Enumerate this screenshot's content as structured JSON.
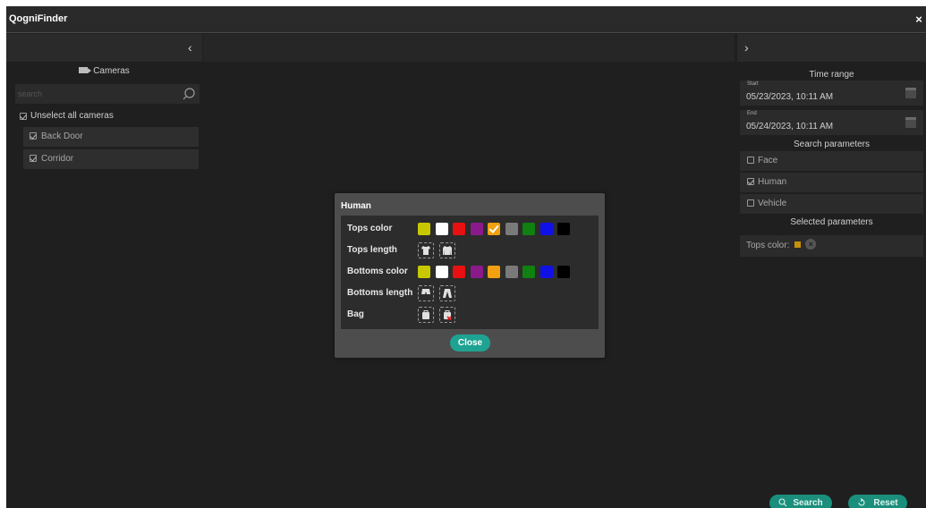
{
  "app": {
    "title": "QogniFinder",
    "close_glyph": "×"
  },
  "nav": {
    "left_chevron": "‹",
    "right_chevron": "›"
  },
  "cameras": {
    "header": "Cameras",
    "search_placeholder": "search",
    "unselect_all_label": "Unselect all cameras",
    "items": [
      {
        "label": "Back Door",
        "checked": true
      },
      {
        "label": "Corridor",
        "checked": true
      }
    ]
  },
  "time_range": {
    "title": "Time range",
    "start_label": "Start",
    "start_value": "05/23/2023, 10:11 AM",
    "end_label": "End",
    "end_value": "05/24/2023, 10:11 AM"
  },
  "search_parameters": {
    "title": "Search parameters",
    "items": [
      {
        "label": "Face",
        "checked": false
      },
      {
        "label": "Human",
        "checked": true
      },
      {
        "label": "Vehicle",
        "checked": false
      }
    ]
  },
  "selected_parameters": {
    "title": "Selected parameters",
    "tops_color_label": "Tops color:",
    "tops_color_value": "#c8900a"
  },
  "actions": {
    "search_label": "Search",
    "reset_label": "Reset"
  },
  "modal": {
    "title": "Human",
    "tops_color_label": "Tops color",
    "tops_length_label": "Tops length",
    "bottoms_color_label": "Bottoms color",
    "bottoms_length_label": "Bottoms length",
    "bag_label": "Bag",
    "close_label": "Close",
    "palette": [
      "#c8c800",
      "#ffffff",
      "#e81010",
      "#8a1a8a",
      "#f0a010",
      "#7a7a7a",
      "#108010",
      "#1010e8",
      "#000000"
    ],
    "palette_names": [
      "yellow",
      "white",
      "red",
      "purple",
      "orange",
      "gray",
      "green",
      "blue",
      "black"
    ],
    "tops_color_selected_index": 4
  }
}
